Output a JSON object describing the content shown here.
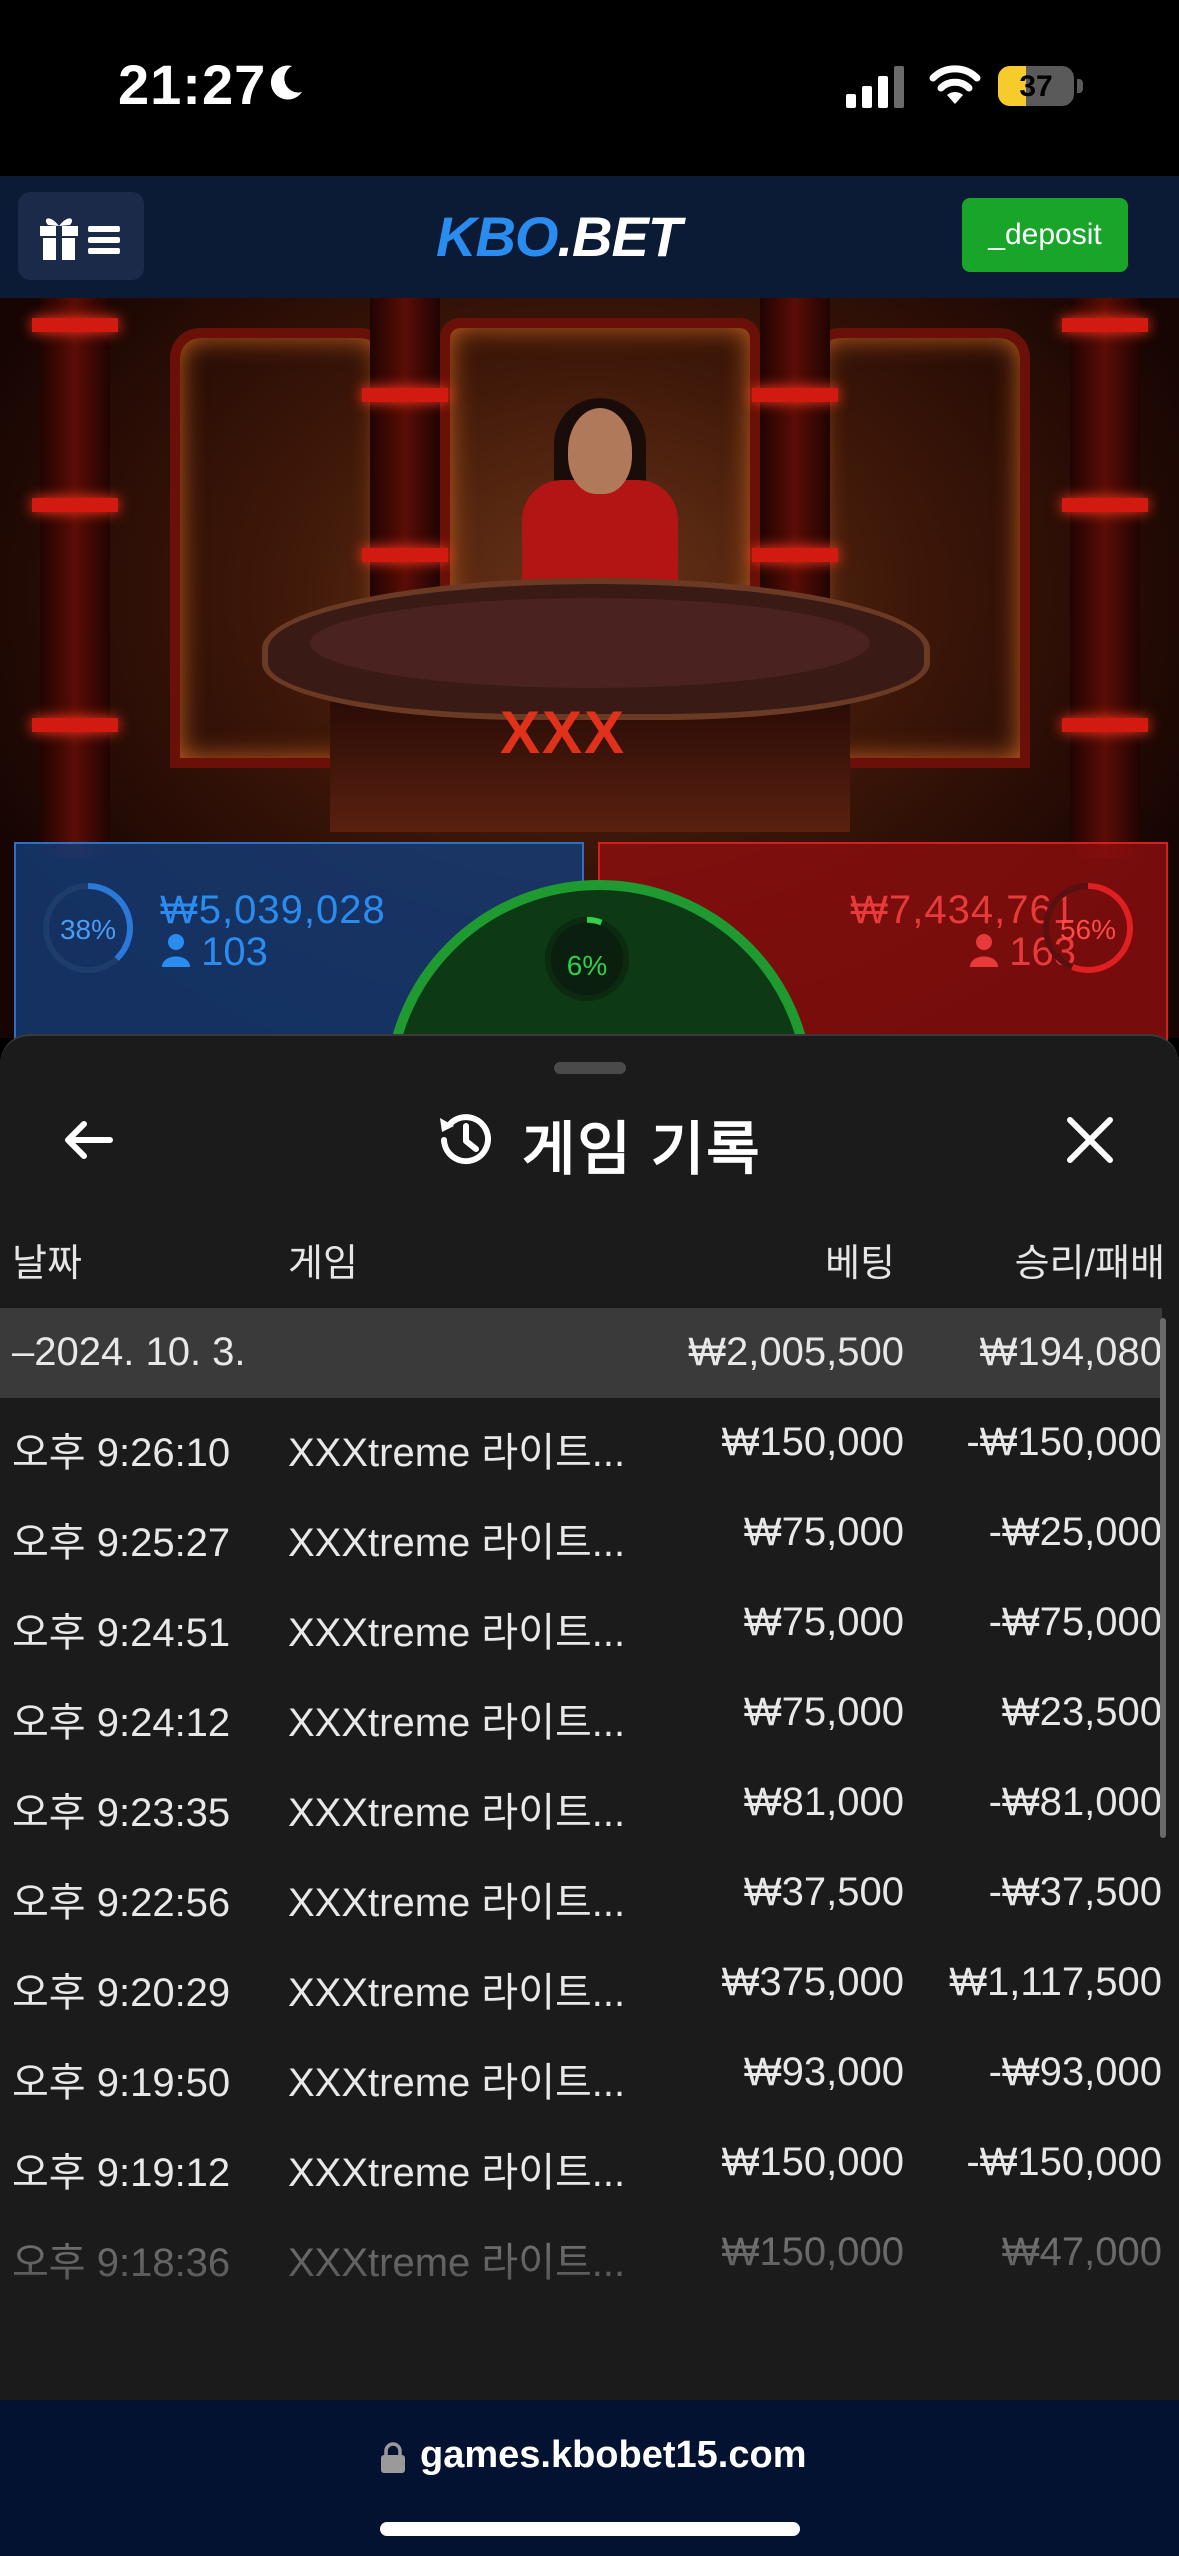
{
  "status_bar": {
    "time": "21:27",
    "battery_percent": "37",
    "battery_level": 0.37,
    "icons": [
      "moon-icon",
      "cellular-signal-icon",
      "wifi-icon",
      "battery-icon"
    ]
  },
  "header": {
    "logo_part1": "KBO",
    "logo_part2": ".BET",
    "deposit_label": "_deposit",
    "menu_icons": [
      "gift-icon",
      "hamburger-icon"
    ],
    "colors": {
      "background": "#0b1a35",
      "logo_blue": "#2b8cf0",
      "deposit_green": "#18a52a"
    }
  },
  "live_game": {
    "table_logo": "XXX",
    "player_side": {
      "percent_label": "38%",
      "percent": 38,
      "amount": "₩5,039,028",
      "players": "103",
      "color": "#2b78d8"
    },
    "tie": {
      "percent_label": "6%",
      "percent": 6,
      "color": "#32d04a"
    },
    "banker_side": {
      "percent_label": "56%",
      "percent": 56,
      "amount": "₩7,434,761",
      "players": "163",
      "color": "#e02020"
    }
  },
  "history_sheet": {
    "title": "게임 기록",
    "icons": [
      "back-arrow-icon",
      "history-icon",
      "close-icon"
    ],
    "columns": {
      "date": "날짜",
      "game": "게임",
      "bet": "베팅",
      "result": "승리/패배"
    },
    "group": {
      "date": "–2024. 10. 3.",
      "bet": "₩2,005,500",
      "result": "₩194,080"
    },
    "rows": [
      {
        "time": "오후 9:26:10",
        "game": "XXXtreme 라이트...",
        "bet": "₩150,000",
        "result": "-₩150,000"
      },
      {
        "time": "오후 9:25:27",
        "game": "XXXtreme 라이트...",
        "bet": "₩75,000",
        "result": "-₩25,000"
      },
      {
        "time": "오후 9:24:51",
        "game": "XXXtreme 라이트...",
        "bet": "₩75,000",
        "result": "-₩75,000"
      },
      {
        "time": "오후 9:24:12",
        "game": "XXXtreme 라이트...",
        "bet": "₩75,000",
        "result": "₩23,500"
      },
      {
        "time": "오후 9:23:35",
        "game": "XXXtreme 라이트...",
        "bet": "₩81,000",
        "result": "-₩81,000"
      },
      {
        "time": "오후 9:22:56",
        "game": "XXXtreme 라이트...",
        "bet": "₩37,500",
        "result": "-₩37,500"
      },
      {
        "time": "오후 9:20:29",
        "game": "XXXtreme 라이트...",
        "bet": "₩375,000",
        "result": "₩1,117,500"
      },
      {
        "time": "오후 9:19:50",
        "game": "XXXtreme 라이트...",
        "bet": "₩93,000",
        "result": "-₩93,000"
      },
      {
        "time": "오후 9:19:12",
        "game": "XXXtreme 라이트...",
        "bet": "₩150,000",
        "result": "-₩150,000"
      },
      {
        "time": "오후 9:18:36",
        "game": "XXXtreme 라이트...",
        "bet": "₩150,000",
        "result": "₩47,000"
      }
    ]
  },
  "browser": {
    "url": "games.kbobet15.com",
    "icons": [
      "lock-icon"
    ]
  }
}
